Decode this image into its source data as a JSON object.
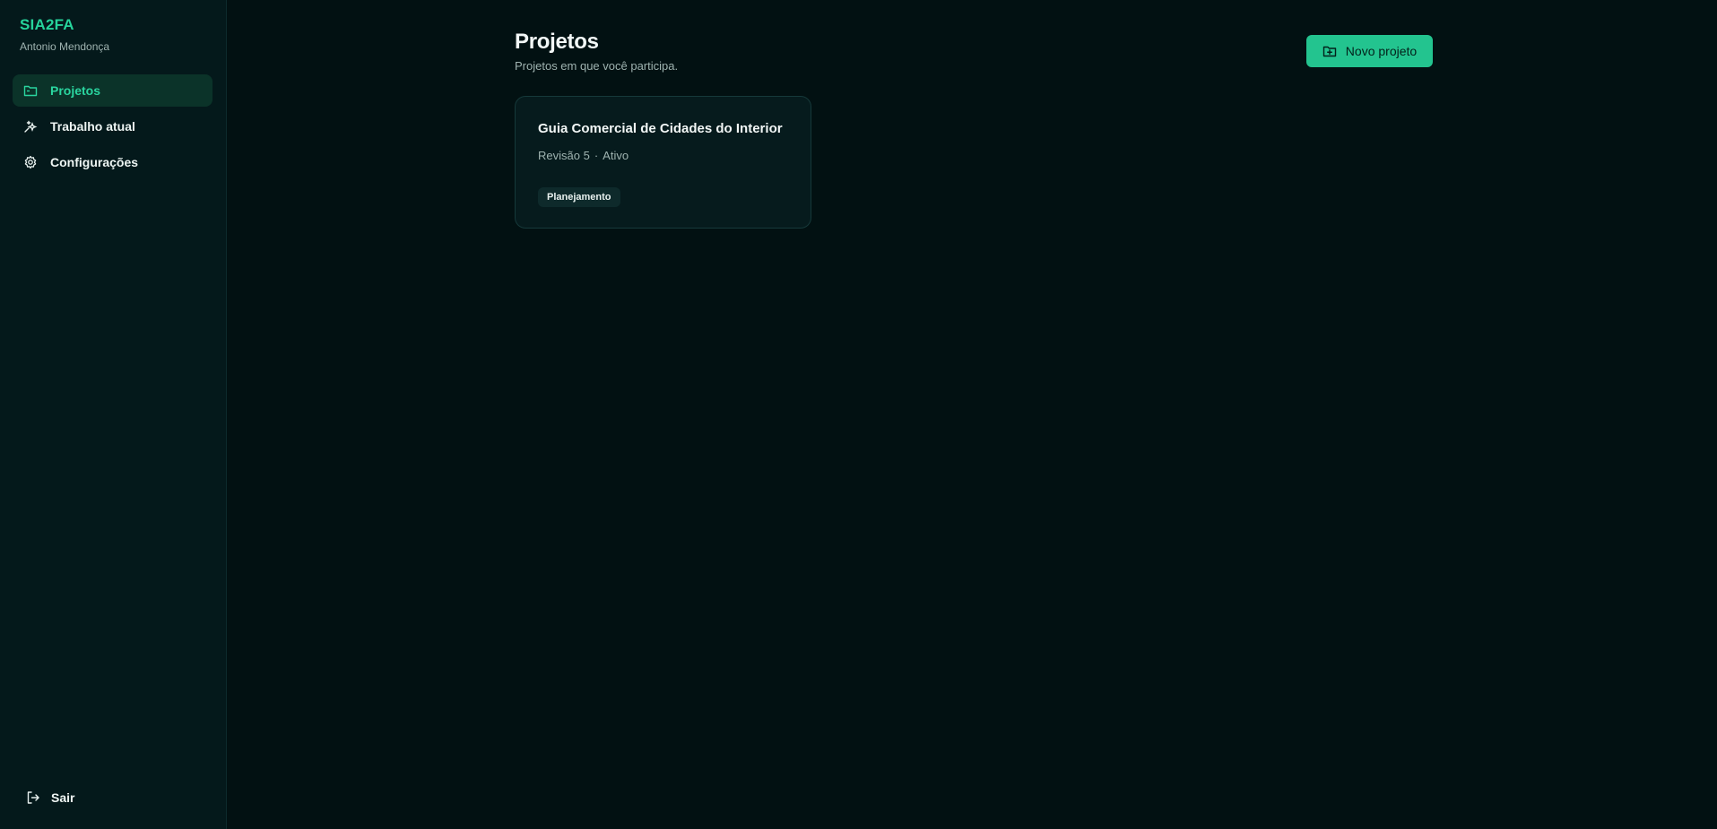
{
  "app": {
    "brand": "SIA2FA",
    "user_name": "Antonio Mendonça"
  },
  "sidebar": {
    "items": [
      {
        "label": "Projetos",
        "icon": "folder-icon",
        "active": true
      },
      {
        "label": "Trabalho atual",
        "icon": "sparkles-icon",
        "active": false
      },
      {
        "label": "Configurações",
        "icon": "gear-icon",
        "active": false
      }
    ],
    "logout_label": "Sair",
    "logout_icon": "logout-icon"
  },
  "main": {
    "title": "Projetos",
    "subtitle": "Projetos em que você participa.",
    "new_button_label": "Novo projeto",
    "new_button_icon": "folder-plus-icon",
    "projects": [
      {
        "title": "Guia Comercial de Cidades do Interior",
        "revision": "Revisão 5",
        "separator": "·",
        "status": "Ativo",
        "badge": "Planejamento"
      }
    ]
  },
  "colors": {
    "background": "#021112",
    "sidebar_background": "#04191b",
    "accent": "#23c48f",
    "accent_text": "#2ad59f",
    "muted_text": "#9fb3b0"
  }
}
